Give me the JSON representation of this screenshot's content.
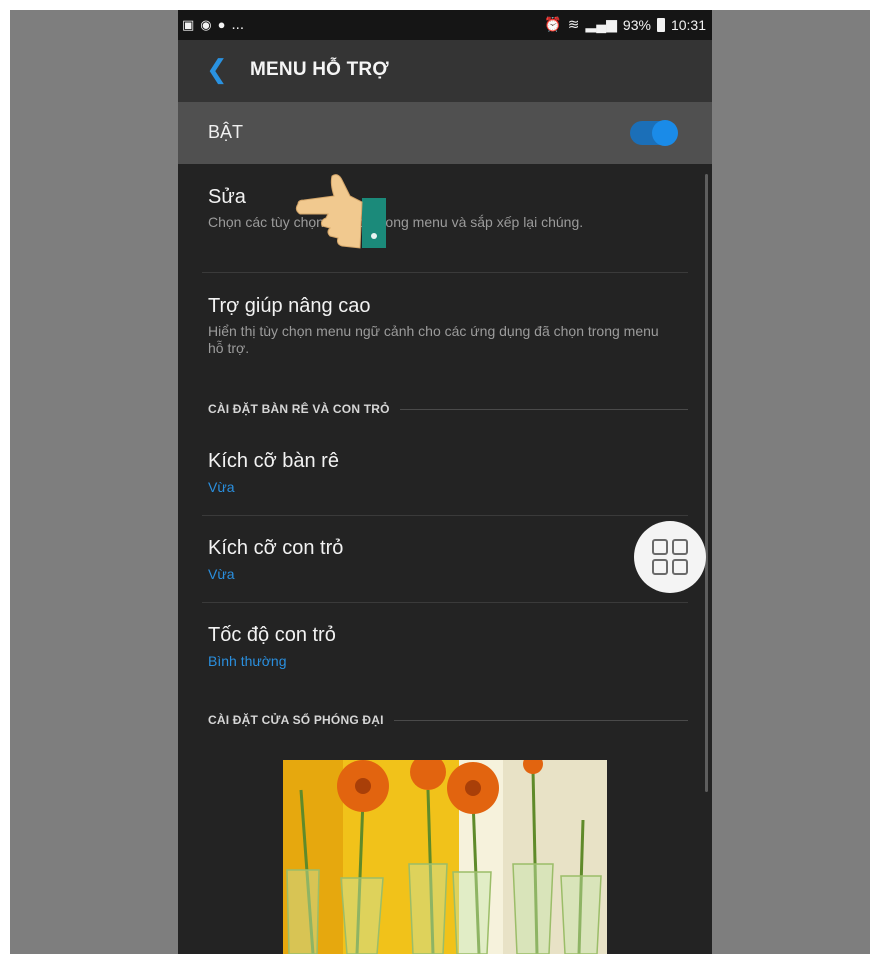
{
  "statusbar": {
    "left_icons": [
      "image-icon",
      "sync-icon",
      "chat-icon"
    ],
    "more": "...",
    "battery": "93%",
    "time": "10:31"
  },
  "appbar": {
    "title": "MENU HỖ TRỢ"
  },
  "master_switch": {
    "label": "BẬT",
    "on": true,
    "color": "#1a8be8"
  },
  "items": {
    "edit": {
      "title": "Sửa",
      "desc": "Chọn các tùy chọn hiển thị trong menu và sắp xếp lại chúng."
    },
    "advanced": {
      "title": "Trợ giúp nâng cao",
      "desc": "Hiển thị tùy chọn menu ngữ cảnh cho các ứng dụng đã chọn trong menu hỗ trợ."
    },
    "section_pad": "CÀI ĐẶT BÀN RÊ VÀ CON TRỎ",
    "pad_size": {
      "title": "Kích cỡ bàn rê",
      "value": "Vừa"
    },
    "pointer_size": {
      "title": "Kích cỡ con trỏ",
      "value": "Vừa"
    },
    "pointer_speed": {
      "title": "Tốc độ con trỏ",
      "value": "Bình thường"
    },
    "section_zoom": "CÀI ĐẶT CỬA SỔ PHÓNG ĐẠI"
  },
  "colors": {
    "accent": "#2a8fde",
    "background": "#232323",
    "appbar": "#343434"
  }
}
